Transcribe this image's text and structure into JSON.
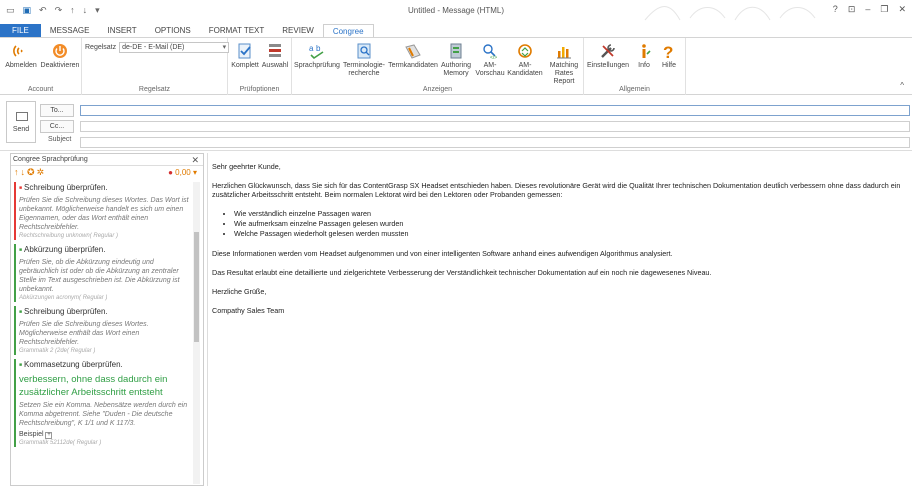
{
  "window": {
    "title": "Untitled - Message (HTML)",
    "help": "?",
    "restore": "⊡",
    "minimize": "–",
    "maximize": "❐",
    "close": "✕"
  },
  "qat": {
    "undo": "↶",
    "redo": "↷",
    "up": "↑",
    "down": "↓",
    "more": "▾"
  },
  "tabs": [
    "FILE",
    "MESSAGE",
    "INSERT",
    "OPTIONS",
    "FORMAT TEXT",
    "REVIEW",
    "Congree"
  ],
  "ribbon": {
    "account": {
      "label": "Account",
      "abmelden": "Abmelden",
      "deaktivieren": "Deaktivieren"
    },
    "regelsatz": {
      "label": "Regelsatz",
      "caption": "Regelsatz",
      "value": "de-DE - E-Mail (DE)"
    },
    "pruefoptionen": {
      "label": "Prüfoptionen",
      "komplett": "Komplett",
      "auswahl": "Auswahl"
    },
    "anzeigen": {
      "label": "Anzeigen",
      "sprachpruefung": "Sprachprüfung",
      "terminologie1": "Terminologie-",
      "terminologie2": "recherche",
      "termkandidaten": "Termkandidaten",
      "authoring1": "Authoring",
      "authoring2": "Memory",
      "am_vorschau1": "AM-",
      "am_vorschau2": "Vorschau",
      "am_kandidaten1": "AM-",
      "am_kandidaten2": "Kandidaten",
      "matching1": "Matching",
      "matching2": "Rates Report"
    },
    "allgemein": {
      "label": "Allgemein",
      "einstellungen": "Einstellungen",
      "info": "Info",
      "hilfe": "Hilfe"
    },
    "collapse": "^"
  },
  "compose": {
    "send": "Send",
    "to": "To...",
    "cc": "Cc...",
    "subject": "Subject"
  },
  "pane": {
    "title": "Congree Sprachprüfung",
    "close": "✕",
    "score": "0,00",
    "items": [
      {
        "head": "Schreibung überprüfen.",
        "desc": "Prüfen Sie die Schreibung dieses Wortes. Das Wort ist unbekannt. Möglicherweise handelt es sich um einen Eigennamen, oder das Wort enthält einen Rechtschreibfehler.",
        "tag": "Rechtschreibung unknown( Regular )",
        "color": "#e53935"
      },
      {
        "head": "Abkürzung überprüfen.",
        "desc": "Prüfen Sie, ob die Abkürzung eindeutig und gebräuchlich ist oder ob die Abkürzung an zentraler Stelle im Text ausgeschrieben ist. Die Abkürzung ist unbekannt.",
        "tag": "Abkürzungen acronym( Regular )",
        "color": "#43a047"
      },
      {
        "head": "Schreibung überprüfen.",
        "desc": "Prüfen Sie die Schreibung dieses Wortes. Möglicherweise enthält das Wort einen Rechtschreibfehler.",
        "tag": "Grammatik 2 (2de( Regular )",
        "color": "#43a047"
      },
      {
        "head": "Kommasetzung überprüfen.",
        "quote": "verbessern, ohne dass dadurch ein zusätzlicher Arbeitsschritt entsteht",
        "desc": "Setzen Sie ein Komma. Nebensätze werden durch ein Komma abgetrennt. Siehe \"Duden - Die deutsche Rechtschreibung\", K 1/1 und K 117/3.",
        "beispiel": "Beispiel",
        "tag": "Grammatik 52112de( Regular )",
        "color": "#43a047"
      }
    ]
  },
  "body": {
    "greeting": "Sehr geehrter Kunde,",
    "para1": "Herzlichen Glückwunsch, dass Sie sich für das ContentGrasp SX Headset entschieden haben. Dieses revolutionäre Gerät wird die Qualität Ihrer technischen Dokumentation deutlich verbessern ohne dass dadurch ein zusätzlicher Arbeitsschritt entsteht. Beim normalen Lektorat wird bei den Lektoren oder Probanden gemessen:",
    "bullets": [
      "Wie verständlich einzelne Passagen waren",
      "Wie aufmerksam einzelne Passagen gelesen wurden",
      "Welche Passagen wiederholt gelesen werden mussten"
    ],
    "para2": "Diese Informationen werden vom Headset aufgenommen und von einer intelligenten Software anhand eines aufwendigen Algorithmus analysiert.",
    "para3": "Das Resultat erlaubt eine detaillierte und zielgerichtete Verbesserung der Verständlichkeit technischer Dokumentation auf ein noch nie dagewesenes Niveau.",
    "closing": "Herzliche Grüße,",
    "signature": "Compathy Sales Team"
  },
  "colors": {
    "accent": "#2b73c7",
    "congree_orange": "#e07b00",
    "green": "#43a047",
    "red": "#e53935"
  }
}
